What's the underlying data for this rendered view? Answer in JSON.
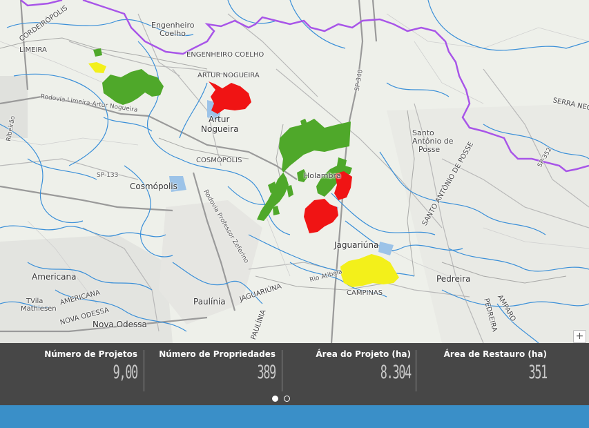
{
  "map": {
    "places": [
      {
        "id": "cordeiropolis",
        "label": "CORDEIRÓPOLIS"
      },
      {
        "id": "limeira",
        "label": "LIMEIRA"
      },
      {
        "id": "engenheiro-coelho-1",
        "label": "Engenheiro"
      },
      {
        "id": "engenheiro-coelho-2",
        "label": "Coelho"
      },
      {
        "id": "engenheiro-coelho-caps",
        "label": "ENGENHEIRO COELHO"
      },
      {
        "id": "artur-nogueira-caps",
        "label": "ARTUR NOGUEIRA"
      },
      {
        "id": "artur-1",
        "label": "Artur"
      },
      {
        "id": "artur-2",
        "label": "Nogueira"
      },
      {
        "id": "cosmopolis-caps",
        "label": "COSMÓPOLIS"
      },
      {
        "id": "cosmopolis",
        "label": "Cosmópolis"
      },
      {
        "id": "holambra",
        "label": "Holambra"
      },
      {
        "id": "santo-antonio-1",
        "label": "Santo"
      },
      {
        "id": "santo-antonio-2",
        "label": "Antônio de"
      },
      {
        "id": "santo-antonio-3",
        "label": "Posse"
      },
      {
        "id": "santo-antonio-caps",
        "label": "SANTO ANTÔNIO DE POSSE"
      },
      {
        "id": "serra-negra",
        "label": "SERRA NEG"
      },
      {
        "id": "jaguariuna",
        "label": "Jaguariúna"
      },
      {
        "id": "jaguariuna-caps",
        "label": "JAGUARIÚNA"
      },
      {
        "id": "americana",
        "label": "Americana"
      },
      {
        "id": "americana-caps",
        "label": "AMERICANA"
      },
      {
        "id": "vila",
        "label": "TVila"
      },
      {
        "id": "mathiesen",
        "label": "Mathiesen"
      },
      {
        "id": "nova-odessa-caps",
        "label": "NOVA ODESSA"
      },
      {
        "id": "nova-odessa",
        "label": "Nova Odessa"
      },
      {
        "id": "paulinia",
        "label": "Paulínia"
      },
      {
        "id": "paulinia-caps",
        "label": "PAULÍNIA"
      },
      {
        "id": "campinas",
        "label": "CAMPINAS"
      },
      {
        "id": "pedreira",
        "label": "Pedreira"
      },
      {
        "id": "pedreira-caps",
        "label": "PEDREIRA"
      },
      {
        "id": "amparo",
        "label": "AMPARO"
      },
      {
        "id": "sp-340",
        "label": "SP-340"
      },
      {
        "id": "sp-133",
        "label": "SP-133"
      },
      {
        "id": "sp-352",
        "label": "SP-352"
      },
      {
        "id": "rodovia-limeira",
        "label": "Rodovia Limeira-Artur Nogueira"
      },
      {
        "id": "rodovia-professor",
        "label": "Rodovia Professor Zeferino"
      },
      {
        "id": "rio-atibaia",
        "label": "Rio Atibaia"
      },
      {
        "id": "ribeirao",
        "label": "Ribeirão"
      }
    ],
    "zoom_label": "+"
  },
  "stats": {
    "items": [
      {
        "label": "Número de Projetos",
        "value": "9,00"
      },
      {
        "label": "Número de Propriedades",
        "value": "389"
      },
      {
        "label": "Área do Projeto (ha)",
        "value": "8.304"
      },
      {
        "label": "Área de Restauro (ha)",
        "value": "351"
      }
    ],
    "pages": [
      {
        "label": "page-1",
        "active": true
      },
      {
        "label": "page-2",
        "active": false
      }
    ]
  },
  "colors": {
    "green": "#4fa82a",
    "red": "#f01414",
    "yellow": "#f3f01a",
    "rivers": "#3a8fd8",
    "boundary": "#a855e8",
    "panel": "#474747",
    "bar": "#3a8fc8"
  }
}
